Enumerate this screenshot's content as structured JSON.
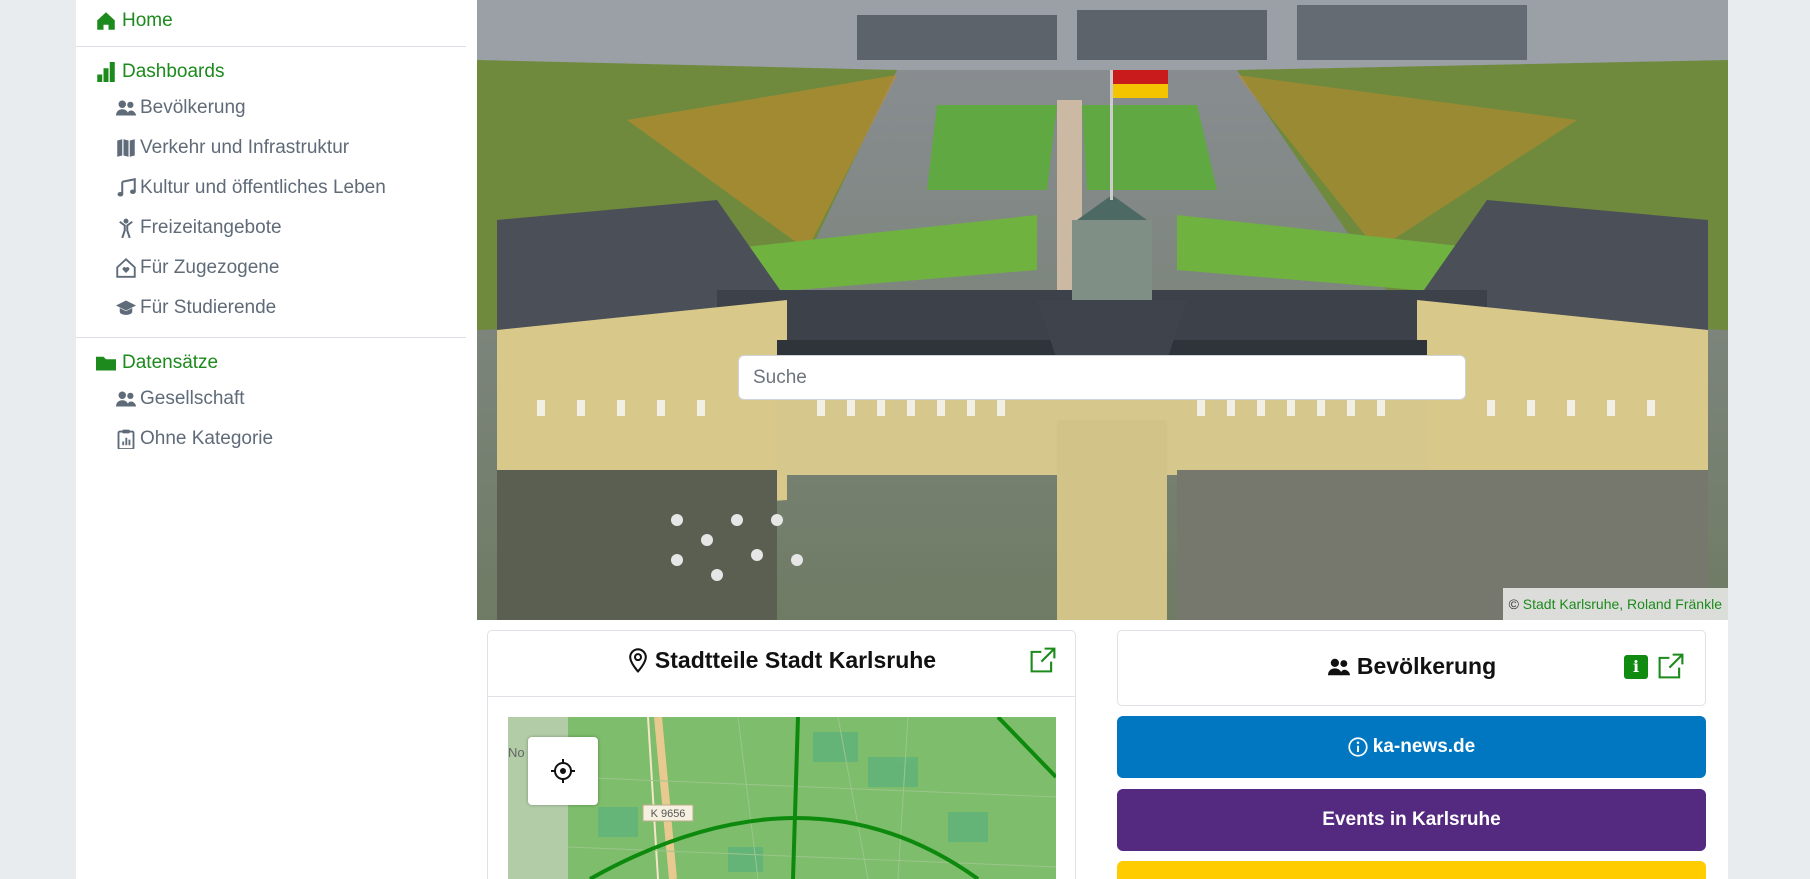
{
  "sidebar": {
    "home": {
      "label": "Home",
      "icon": "house-icon"
    },
    "dashboards": {
      "label": "Dashboards",
      "icon": "bar-chart-icon",
      "items": [
        {
          "label": "Bevölkerung",
          "icon": "people-icon"
        },
        {
          "label": "Verkehr und Infrastruktur",
          "icon": "map-icon"
        },
        {
          "label": "Kultur und öffentliches Leben",
          "icon": "music-note-icon"
        },
        {
          "label": "Freizeitangebote",
          "icon": "person-icon"
        },
        {
          "label": "Für Zugezogene",
          "icon": "house-heart-icon"
        },
        {
          "label": "Für Studierende",
          "icon": "mortarboard-icon"
        }
      ]
    },
    "datasets": {
      "label": "Datensätze",
      "icon": "folder-icon",
      "items": [
        {
          "label": "Gesellschaft",
          "icon": "people-icon"
        },
        {
          "label": "Ohne Kategorie",
          "icon": "clipboard-data-icon"
        }
      ]
    }
  },
  "hero": {
    "search_placeholder": "Suche",
    "credit_prefix": "©",
    "credit_link": "Stadt Karlsruhe, Roland Fränkle"
  },
  "cards": {
    "map_card": {
      "title": "Stadtteile Stadt Karlsruhe",
      "icon": "geo-pin-icon"
    },
    "population_card": {
      "title": "Bevölkerung",
      "icon": "people-icon",
      "info": "i"
    }
  },
  "map": {
    "road_label": "K 9656",
    "edge_label": "No"
  },
  "links": [
    {
      "label": "ka-news.de",
      "icon": "info-circle-icon",
      "color": "#0077c0"
    },
    {
      "label": "Events in Karlsruhe",
      "color": "#542a80"
    },
    {
      "label": "",
      "color": "#ffcc00"
    }
  ],
  "colors": {
    "accent": "#1c8a1c",
    "muted": "#5f6b78",
    "background": "#e9ecef"
  }
}
